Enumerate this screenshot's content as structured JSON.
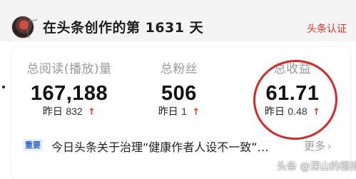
{
  "header": {
    "headline": "在头条创作的第 1631 天",
    "certification_link": "头条认证"
  },
  "stats": {
    "reads": {
      "label": "总阅读(播放)量",
      "value": "167,188",
      "yesterday_label": "昨日",
      "yesterday_value": "832",
      "trend_icon": "arrow-up-icon"
    },
    "fans": {
      "label": "总粉丝",
      "value": "506",
      "yesterday_label": "昨日",
      "yesterday_value": "1",
      "trend_icon": "arrow-up-icon"
    },
    "income": {
      "label": "总收益",
      "value": "61.71",
      "yesterday_label": "昨日",
      "yesterday_value": "0.48",
      "trend_icon": "arrow-up-icon"
    }
  },
  "news": {
    "badge": "重要",
    "text": "今日头条关于治理“健康作者人设不一致”…",
    "more_label": "更多"
  },
  "watermark": "头条 @深山的襁褓",
  "colors": {
    "accent_red": "#e5352b",
    "label_gray": "#9a9a9a",
    "badge_blue": "#2a62d6",
    "annotation_circle": "#d8282a"
  }
}
